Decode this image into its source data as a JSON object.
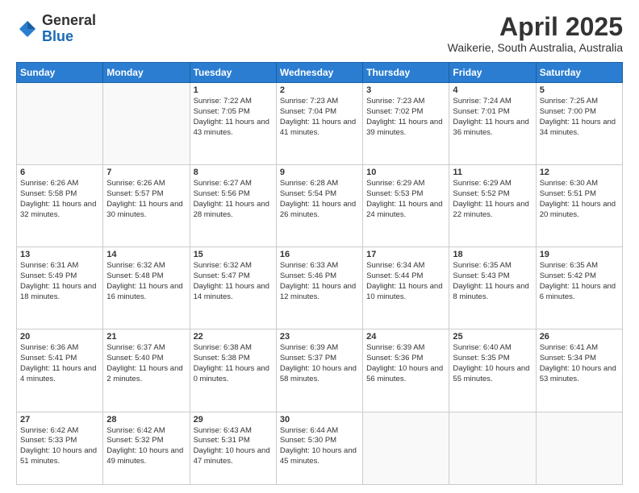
{
  "header": {
    "logo": {
      "line1": "General",
      "line2": "Blue"
    },
    "title": "April 2025",
    "subtitle": "Waikerie, South Australia, Australia"
  },
  "calendar": {
    "days_of_week": [
      "Sunday",
      "Monday",
      "Tuesday",
      "Wednesday",
      "Thursday",
      "Friday",
      "Saturday"
    ],
    "weeks": [
      [
        {
          "day": "",
          "info": ""
        },
        {
          "day": "",
          "info": ""
        },
        {
          "day": "1",
          "info": "Sunrise: 7:22 AM\nSunset: 7:05 PM\nDaylight: 11 hours and 43 minutes."
        },
        {
          "day": "2",
          "info": "Sunrise: 7:23 AM\nSunset: 7:04 PM\nDaylight: 11 hours and 41 minutes."
        },
        {
          "day": "3",
          "info": "Sunrise: 7:23 AM\nSunset: 7:02 PM\nDaylight: 11 hours and 39 minutes."
        },
        {
          "day": "4",
          "info": "Sunrise: 7:24 AM\nSunset: 7:01 PM\nDaylight: 11 hours and 36 minutes."
        },
        {
          "day": "5",
          "info": "Sunrise: 7:25 AM\nSunset: 7:00 PM\nDaylight: 11 hours and 34 minutes."
        }
      ],
      [
        {
          "day": "6",
          "info": "Sunrise: 6:26 AM\nSunset: 5:58 PM\nDaylight: 11 hours and 32 minutes."
        },
        {
          "day": "7",
          "info": "Sunrise: 6:26 AM\nSunset: 5:57 PM\nDaylight: 11 hours and 30 minutes."
        },
        {
          "day": "8",
          "info": "Sunrise: 6:27 AM\nSunset: 5:56 PM\nDaylight: 11 hours and 28 minutes."
        },
        {
          "day": "9",
          "info": "Sunrise: 6:28 AM\nSunset: 5:54 PM\nDaylight: 11 hours and 26 minutes."
        },
        {
          "day": "10",
          "info": "Sunrise: 6:29 AM\nSunset: 5:53 PM\nDaylight: 11 hours and 24 minutes."
        },
        {
          "day": "11",
          "info": "Sunrise: 6:29 AM\nSunset: 5:52 PM\nDaylight: 11 hours and 22 minutes."
        },
        {
          "day": "12",
          "info": "Sunrise: 6:30 AM\nSunset: 5:51 PM\nDaylight: 11 hours and 20 minutes."
        }
      ],
      [
        {
          "day": "13",
          "info": "Sunrise: 6:31 AM\nSunset: 5:49 PM\nDaylight: 11 hours and 18 minutes."
        },
        {
          "day": "14",
          "info": "Sunrise: 6:32 AM\nSunset: 5:48 PM\nDaylight: 11 hours and 16 minutes."
        },
        {
          "day": "15",
          "info": "Sunrise: 6:32 AM\nSunset: 5:47 PM\nDaylight: 11 hours and 14 minutes."
        },
        {
          "day": "16",
          "info": "Sunrise: 6:33 AM\nSunset: 5:46 PM\nDaylight: 11 hours and 12 minutes."
        },
        {
          "day": "17",
          "info": "Sunrise: 6:34 AM\nSunset: 5:44 PM\nDaylight: 11 hours and 10 minutes."
        },
        {
          "day": "18",
          "info": "Sunrise: 6:35 AM\nSunset: 5:43 PM\nDaylight: 11 hours and 8 minutes."
        },
        {
          "day": "19",
          "info": "Sunrise: 6:35 AM\nSunset: 5:42 PM\nDaylight: 11 hours and 6 minutes."
        }
      ],
      [
        {
          "day": "20",
          "info": "Sunrise: 6:36 AM\nSunset: 5:41 PM\nDaylight: 11 hours and 4 minutes."
        },
        {
          "day": "21",
          "info": "Sunrise: 6:37 AM\nSunset: 5:40 PM\nDaylight: 11 hours and 2 minutes."
        },
        {
          "day": "22",
          "info": "Sunrise: 6:38 AM\nSunset: 5:38 PM\nDaylight: 11 hours and 0 minutes."
        },
        {
          "day": "23",
          "info": "Sunrise: 6:39 AM\nSunset: 5:37 PM\nDaylight: 10 hours and 58 minutes."
        },
        {
          "day": "24",
          "info": "Sunrise: 6:39 AM\nSunset: 5:36 PM\nDaylight: 10 hours and 56 minutes."
        },
        {
          "day": "25",
          "info": "Sunrise: 6:40 AM\nSunset: 5:35 PM\nDaylight: 10 hours and 55 minutes."
        },
        {
          "day": "26",
          "info": "Sunrise: 6:41 AM\nSunset: 5:34 PM\nDaylight: 10 hours and 53 minutes."
        }
      ],
      [
        {
          "day": "27",
          "info": "Sunrise: 6:42 AM\nSunset: 5:33 PM\nDaylight: 10 hours and 51 minutes."
        },
        {
          "day": "28",
          "info": "Sunrise: 6:42 AM\nSunset: 5:32 PM\nDaylight: 10 hours and 49 minutes."
        },
        {
          "day": "29",
          "info": "Sunrise: 6:43 AM\nSunset: 5:31 PM\nDaylight: 10 hours and 47 minutes."
        },
        {
          "day": "30",
          "info": "Sunrise: 6:44 AM\nSunset: 5:30 PM\nDaylight: 10 hours and 45 minutes."
        },
        {
          "day": "",
          "info": ""
        },
        {
          "day": "",
          "info": ""
        },
        {
          "day": "",
          "info": ""
        }
      ]
    ]
  }
}
